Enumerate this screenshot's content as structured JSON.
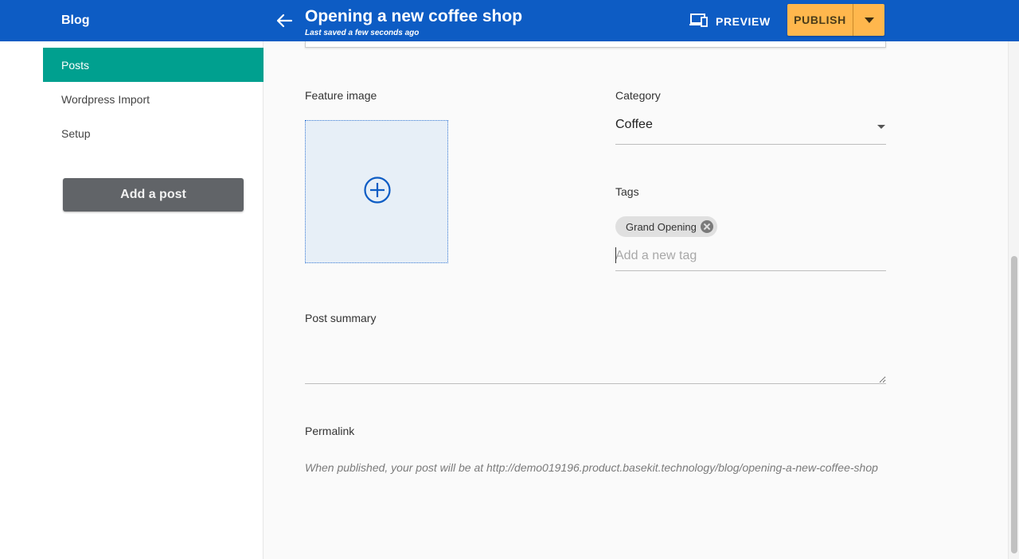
{
  "header": {
    "app_title": "Blog",
    "post_title": "Opening a new coffee shop",
    "saved_status": "Last saved a few seconds ago",
    "preview_label": "PREVIEW",
    "publish_label": "PUBLISH",
    "icons": [
      "arrow-left-icon",
      "devices-icon",
      "caret-down-icon"
    ]
  },
  "sidebar": {
    "items": [
      {
        "label": "Posts",
        "active": true
      },
      {
        "label": "Wordpress Import",
        "active": false
      },
      {
        "label": "Setup",
        "active": false
      }
    ],
    "add_post_label": "Add a post"
  },
  "form": {
    "feature_image_label": "Feature image",
    "category_label": "Category",
    "category_value": "Coffee",
    "tags_label": "Tags",
    "tags": [
      "Grand Opening"
    ],
    "tag_placeholder": "Add a new tag",
    "summary_label": "Post summary",
    "summary_value": "",
    "permalink_label": "Permalink",
    "permalink_text": "When published, your post will be at http://demo019196.product.basekit.technology/blog/opening-a-new-coffee-shop"
  },
  "colors": {
    "header_bg": "#0d5cc4",
    "active_nav": "#00a08f",
    "publish_button": "#ffb74d",
    "add_post_button": "#616468"
  }
}
